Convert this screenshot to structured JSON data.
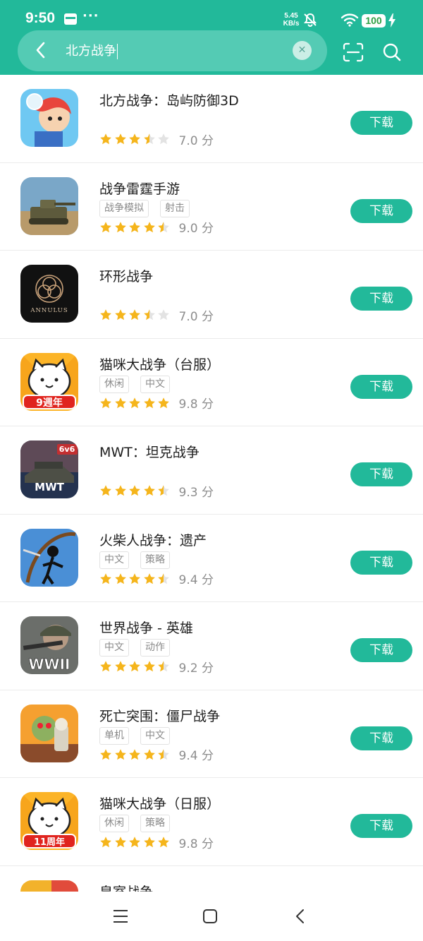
{
  "status_bar": {
    "time": "9:50",
    "notification_more": "···",
    "net_speed_value": "5.45",
    "net_speed_unit": "KB/s",
    "battery": "100"
  },
  "search": {
    "query": "北方战争",
    "clear_icon": "close-icon"
  },
  "download_label": "下载",
  "score_unit": "分",
  "colors": {
    "brand": "#22b99a",
    "star": "#f5b51c",
    "star_empty": "#e3e3e3"
  },
  "apps": [
    {
      "name": "北方战争：岛屿防御3D",
      "tags": [],
      "rating": 3.5,
      "score": "7.0"
    },
    {
      "name": "战争雷霆手游",
      "tags": [
        "战争模拟",
        "射击"
      ],
      "rating": 4.5,
      "score": "9.0"
    },
    {
      "name": "环形战争",
      "tags": [],
      "rating": 3.5,
      "score": "7.0",
      "icon_text": "ANNULUS"
    },
    {
      "name": "猫咪大战争（台服）",
      "tags": [
        "休闲",
        "中文"
      ],
      "rating": 5,
      "score": "9.8",
      "icon_text": "9週年"
    },
    {
      "name": "MWT：坦克战争",
      "tags": [],
      "rating": 4.5,
      "score": "9.3",
      "icon_text": "6v6"
    },
    {
      "name": "火柴人战争：遗产",
      "tags": [
        "中文",
        "策略"
      ],
      "rating": 4.5,
      "score": "9.4"
    },
    {
      "name": "世界战争 - 英雄",
      "tags": [
        "中文",
        "动作"
      ],
      "rating": 4.5,
      "score": "9.2",
      "icon_text": "WWII"
    },
    {
      "name": "死亡突围：僵尸战争",
      "tags": [
        "单机",
        "中文"
      ],
      "rating": 4.5,
      "score": "9.4"
    },
    {
      "name": "猫咪大战争（日服）",
      "tags": [
        "休闲",
        "策略"
      ],
      "rating": 5,
      "score": "9.8",
      "icon_text": "11周年"
    },
    {
      "name": "皇室战争",
      "tags": [],
      "rating": null,
      "score": null
    }
  ]
}
